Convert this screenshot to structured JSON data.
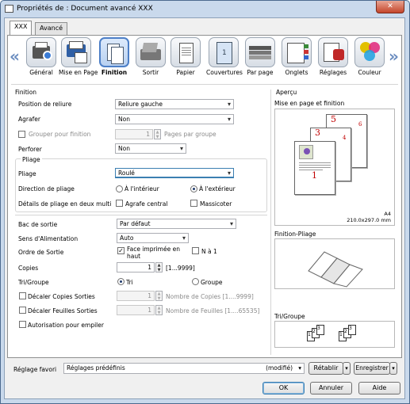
{
  "window": {
    "title": "Propriétés de : Document avancé XXX",
    "close": "✕"
  },
  "tabs": [
    "XXX",
    "Avancé"
  ],
  "ribbon": [
    "Général",
    "Mise en Page",
    "Finition",
    "Sortir",
    "Papier",
    "Couvertures",
    "Par page",
    "Onglets",
    "Réglages",
    "Couleur"
  ],
  "finition": {
    "section": "Finition",
    "position_label": "Position de reliure",
    "position_value": "Reliure gauche",
    "agrafer_label": "Agrafer",
    "agrafer_value": "Non",
    "grouper_label": "Grouper pour finition",
    "grouper_value": "1",
    "grouper_unit": "Pages par groupe",
    "perforer_label": "Perforer",
    "perforer_value": "Non",
    "pliage_section": "Pliage",
    "pliage_label": "Pliage",
    "pliage_value": "Roulé",
    "direction_label": "Direction de pliage",
    "dir_opt1": "À l'intérieur",
    "dir_opt2": "À l'extérieur",
    "details_label": "Détails de pliage en deux multi",
    "agrafe_central": "Agrafe central",
    "massicoter": "Massicoter"
  },
  "sortie": {
    "bac_label": "Bac de sortie",
    "bac_value": "Par défaut",
    "sens_label": "Sens d'Alimentation",
    "sens_value": "Auto",
    "ordre_label": "Ordre de Sortie",
    "face_label": "Face imprimée en haut",
    "na1_label": "N à 1",
    "copies_label": "Copies",
    "copies_value": "1",
    "copies_range": "[1...9999]",
    "tri_label": "Tri/Groupe",
    "tri_opt": "Tri",
    "groupe_opt": "Groupe",
    "decaler_copies": "Décaler Copies Sorties",
    "decaler_copies_value": "1",
    "decaler_copies_hint": "Nombre de Copies [1....9999]",
    "decaler_feuilles": "Décaler Feuilles Sorties",
    "decaler_feuilles_value": "1",
    "decaler_feuilles_hint": "Nombre de Feuilles [1....65535]",
    "autorisation": "Autorisation pour empiler"
  },
  "apercu": {
    "title": "Aperçu",
    "mise_label": "Mise en page et finition",
    "paper": "A4",
    "paper_size": "210.0x297.0 mm",
    "pages": [
      "1",
      "3",
      "5"
    ],
    "back_pages": [
      "4",
      "6"
    ],
    "pliage_label": "Finition-Pliage",
    "tri_label": "Tri/Groupe",
    "tri_icons": [
      "1",
      "2",
      "3"
    ]
  },
  "footer": {
    "favori_label": "Réglage favori",
    "favori_value": "Réglages prédéfinis",
    "modifie": "(modifié)",
    "retablir": "Rétablir",
    "enregistrer": "Enregistrer",
    "ok": "OK",
    "annuler": "Annuler",
    "aide": "Aide"
  }
}
